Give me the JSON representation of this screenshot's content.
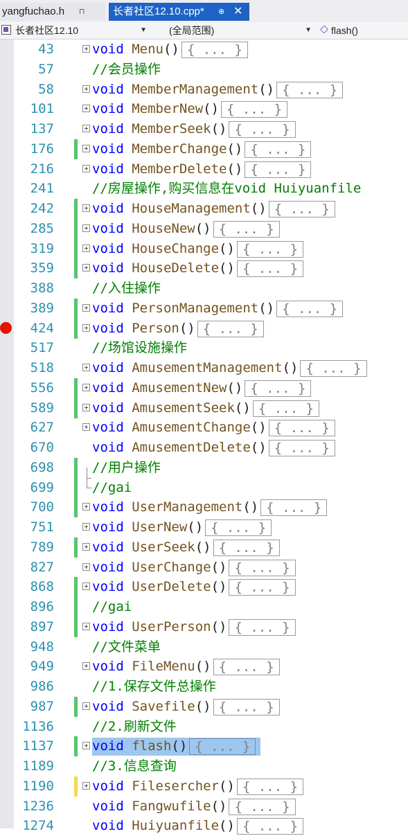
{
  "tabs": [
    {
      "label": "yangfuchao.h",
      "pin": "⊓",
      "active": false
    },
    {
      "label": "长者社区12.10.cpp*",
      "pin": "⊕",
      "active": true,
      "close": "✕"
    }
  ],
  "nav": {
    "scope": "长者社区12.10",
    "range": "(全局范围)",
    "function": "flash()"
  },
  "icons": [
    "project-icon",
    "dropdown-icon",
    "function-cube-icon",
    "fold-expand-icon",
    "breakpoint-icon"
  ],
  "colors": {
    "keyword": "#0000ff",
    "function": "#74531f",
    "comment": "#008000",
    "line_number": "#2b91af",
    "change_saved": "#57c66b",
    "change_unsaved": "#f5d84e",
    "breakpoint": "#e51400",
    "selection": "#9ec7ef",
    "active_tab": "#1e63c4"
  },
  "collapsed_text": "{ ... }",
  "lines": [
    {
      "num": "43",
      "kind": "func",
      "kw": "void",
      "name": "Menu",
      "parens": "()",
      "fold": "plus",
      "mark": ""
    },
    {
      "num": "57",
      "kind": "comment",
      "text": "//会员操作",
      "mark": ""
    },
    {
      "num": "58",
      "kind": "func",
      "kw": "void",
      "name": "MemberManagement",
      "parens": "()",
      "fold": "plus",
      "mark": ""
    },
    {
      "num": "101",
      "kind": "func",
      "kw": "void",
      "name": "MemberNew",
      "parens": "()",
      "fold": "plus",
      "mark": ""
    },
    {
      "num": "137",
      "kind": "func",
      "kw": "void",
      "name": "MemberSeek",
      "parens": "()",
      "fold": "plus",
      "mark": ""
    },
    {
      "num": "176",
      "kind": "func",
      "kw": "void",
      "name": "MemberChange",
      "parens": "()",
      "fold": "plus",
      "mark": "green"
    },
    {
      "num": "216",
      "kind": "func",
      "kw": "void",
      "name": "MemberDelete",
      "parens": "()",
      "fold": "plus",
      "mark": ""
    },
    {
      "num": "241",
      "kind": "comment",
      "text": "//房屋操作,购买信息在void Huiyuanfile",
      "mark": ""
    },
    {
      "num": "242",
      "kind": "func",
      "kw": "void",
      "name": "HouseManagement",
      "parens": "()",
      "fold": "plus",
      "mark": "green"
    },
    {
      "num": "285",
      "kind": "func",
      "kw": "void",
      "name": "HouseNew",
      "parens": "()",
      "fold": "plus",
      "mark": "green"
    },
    {
      "num": "319",
      "kind": "func",
      "kw": "void",
      "name": "HouseChange",
      "parens": "()",
      "fold": "plus",
      "mark": "green"
    },
    {
      "num": "359",
      "kind": "func",
      "kw": "void",
      "name": "HouseDelete",
      "parens": "()",
      "fold": "plus",
      "mark": "green"
    },
    {
      "num": "388",
      "kind": "comment",
      "text": "//入住操作",
      "mark": ""
    },
    {
      "num": "389",
      "kind": "func",
      "kw": "void",
      "name": "PersonManagement",
      "parens": "()",
      "fold": "plus",
      "mark": "green"
    },
    {
      "num": "424",
      "kind": "func",
      "kw": "void",
      "name": "Person",
      "parens": "()",
      "fold": "plus",
      "mark": "green",
      "breakpoint": true
    },
    {
      "num": "517",
      "kind": "comment",
      "text": "//场馆设施操作",
      "mark": ""
    },
    {
      "num": "518",
      "kind": "func",
      "kw": "void",
      "name": "AmusementManagement",
      "parens": "()",
      "fold": "plus",
      "mark": ""
    },
    {
      "num": "556",
      "kind": "func",
      "kw": "void",
      "name": "AmusementNew",
      "parens": "()",
      "fold": "plus",
      "mark": "green"
    },
    {
      "num": "589",
      "kind": "func",
      "kw": "void",
      "name": "AmusementSeek",
      "parens": "()",
      "fold": "plus",
      "mark": "green"
    },
    {
      "num": "627",
      "kind": "func",
      "kw": "void",
      "name": "AmusementChange",
      "parens": "()",
      "fold": "plus",
      "mark": ""
    },
    {
      "num": "670",
      "kind": "func",
      "kw": "void",
      "name": "AmusementDelete",
      "parens": "()",
      "fold": "none",
      "mark": ""
    },
    {
      "num": "698",
      "kind": "comment",
      "text": "//用户操作",
      "mark": "green",
      "fold": "bracket-top"
    },
    {
      "num": "699",
      "kind": "comment",
      "text": "//gai",
      "mark": "green",
      "fold": "bracket-end"
    },
    {
      "num": "700",
      "kind": "func",
      "kw": "void",
      "name": "UserManagement",
      "parens": "()",
      "fold": "plus",
      "mark": "green"
    },
    {
      "num": "751",
      "kind": "func",
      "kw": "void",
      "name": "UserNew",
      "parens": "()",
      "fold": "plus",
      "mark": ""
    },
    {
      "num": "789",
      "kind": "func",
      "kw": "void",
      "name": "UserSeek",
      "parens": "()",
      "fold": "plus",
      "mark": "green"
    },
    {
      "num": "827",
      "kind": "func",
      "kw": "void",
      "name": "UserChange",
      "parens": "()",
      "fold": "plus",
      "mark": ""
    },
    {
      "num": "868",
      "kind": "func",
      "kw": "void",
      "name": "UserDelete",
      "parens": "()",
      "fold": "plus",
      "mark": "green"
    },
    {
      "num": "896",
      "kind": "comment",
      "text": "//gai",
      "mark": "green"
    },
    {
      "num": "897",
      "kind": "func",
      "kw": "void",
      "name": "UserPerson",
      "parens": "()",
      "fold": "plus",
      "mark": "green"
    },
    {
      "num": "948",
      "kind": "comment",
      "text": "//文件菜单",
      "mark": ""
    },
    {
      "num": "949",
      "kind": "func",
      "kw": "void",
      "name": "FileMenu",
      "parens": "()",
      "fold": "plus",
      "mark": ""
    },
    {
      "num": "986",
      "kind": "comment",
      "text": "//1.保存文件总操作",
      "mark": ""
    },
    {
      "num": "987",
      "kind": "func",
      "kw": "void",
      "name": "Savefile",
      "parens": "()",
      "fold": "plus",
      "mark": "green"
    },
    {
      "num": "1136",
      "kind": "comment",
      "text": "//2.刷新文件",
      "mark": ""
    },
    {
      "num": "1137",
      "kind": "func",
      "kw": "void",
      "name": "flash",
      "parens": "()",
      "fold": "plus",
      "mark": "green",
      "selected": true
    },
    {
      "num": "1189",
      "kind": "comment",
      "text": "//3.信息查询",
      "mark": ""
    },
    {
      "num": "1190",
      "kind": "func",
      "kw": "void",
      "name": "Filesercher",
      "parens": "()",
      "fold": "plus",
      "mark": "yellow"
    },
    {
      "num": "1236",
      "kind": "func",
      "kw": "void",
      "name": "Fangwufile",
      "parens": "()",
      "fold": "none",
      "mark": ""
    },
    {
      "num": "1274",
      "kind": "func",
      "kw": "void",
      "name": "Huiyuanfile",
      "parens": "()",
      "fold": "none",
      "mark": ""
    }
  ]
}
